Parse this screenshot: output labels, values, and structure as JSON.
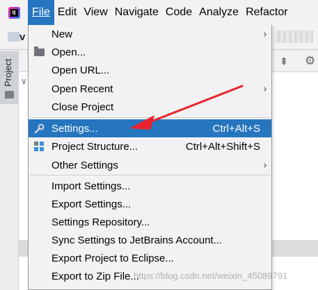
{
  "menubar": {
    "items": [
      {
        "label": "File",
        "active": true
      },
      {
        "label": "Edit"
      },
      {
        "label": "View"
      },
      {
        "label": "Navigate"
      },
      {
        "label": "Code"
      },
      {
        "label": "Analyze"
      },
      {
        "label": "Refactor"
      }
    ]
  },
  "background": {
    "project_initial": "v",
    "side_tab_label": "Project"
  },
  "file_menu": {
    "items": [
      {
        "label": "New",
        "submenu": true
      },
      {
        "label": "Open...",
        "icon": "folder-open-icon"
      },
      {
        "label": "Open URL..."
      },
      {
        "label": "Open Recent",
        "submenu": true
      },
      {
        "label": "Close Project"
      },
      {
        "label": "Settings...",
        "icon": "wrench-icon",
        "shortcut": "Ctrl+Alt+S",
        "selected": true
      },
      {
        "label": "Project Structure...",
        "icon": "project-structure-icon",
        "shortcut": "Ctrl+Alt+Shift+S"
      },
      {
        "label": "Other Settings",
        "submenu": true
      },
      {
        "label": "Import Settings..."
      },
      {
        "label": "Export Settings..."
      },
      {
        "label": "Settings Repository..."
      },
      {
        "label": "Sync Settings to JetBrains Account..."
      },
      {
        "label": "Export Project to Eclipse..."
      },
      {
        "label": "Export to Zip File..."
      }
    ]
  },
  "colors": {
    "accent": "#2675bf",
    "annotation_arrow": "#e8222e"
  },
  "watermark": "https://blog.csdn.net/weixin_45089791"
}
